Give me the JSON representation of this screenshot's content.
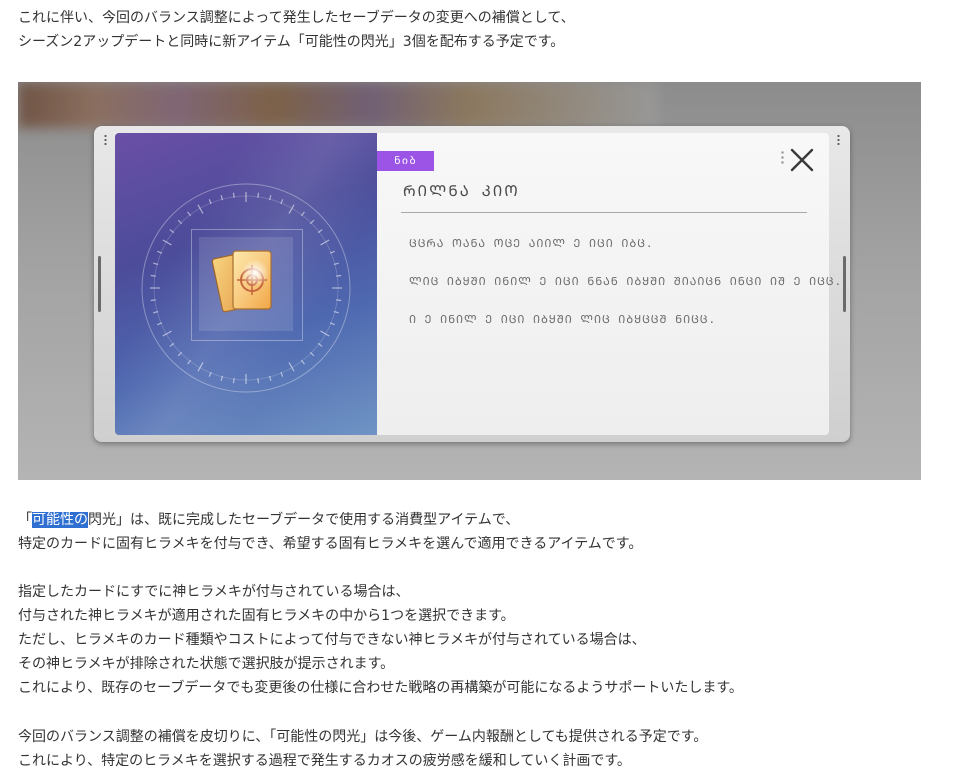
{
  "article": {
    "intro_lines": [
      "これに伴い、今回のバランス調整によって発生したセーブデータの変更への補償として、",
      "シーズン2アップデートと同時に新アイテム「可能性の閃光」3個を配布する予定です。"
    ],
    "desc": {
      "line1_open": "「",
      "line1_highlight": "可能性の",
      "line1_rest": "閃光」は、既に完成したセーブデータで使用する消費型アイテムで、",
      "line2": "特定のカードに固有ヒラメキを付与でき、希望する固有ヒラメキを選んで適用できるアイテムです。"
    },
    "rules_lines": [
      "指定したカードにすでに神ヒラメキが付与されている場合は、",
      "付与された神ヒラメキが適用された固有ヒラメキの中から1つを選択できます。",
      "ただし、ヒラメキのカード種類やコストによって付与できない神ヒラメキが付与されている場合は、",
      "その神ヒラメキが排除された状態で選択肢が提示されます。",
      "これにより、既存のセーブデータでも変更後の仕様に合わせた戦略の再構築が可能になるようサポートいたします。"
    ],
    "closing_lines": [
      "今回のバランス調整の補償を皮切りに、「可能性の閃光」は今後、ゲーム内報酬としても提供される予定です。",
      "これにより、特定のヒラメキを選択する過程で発生するカオスの疲労感を緩和していく計画です。"
    ]
  },
  "game_popup": {
    "tag": "ნიბ",
    "title": "ᲠᲘᲚᲜᲐ ᲙᲘᲝ",
    "desc_lines": [
      "ᲪᲪᲠᲐ ᲝᲐᲜᲐ ᲝᲪᲔ ᲐᲘᲘᲚ Ე ᲘᲪᲘ ᲘᲑᲪ.",
      "ᲚᲘᲪ ᲘᲑᲧᲨᲘ ᲘᲜᲘᲚ Ე ᲘᲪᲘ ᲜᲜᲐᲜ ᲘᲑᲧᲨᲘ ᲨᲘᲐᲘᲪᲜ ᲘᲜᲪᲘ ᲘᲨ Ე ᲘᲪᲪ.",
      "Ი Ე ᲘᲜᲘᲚ Ე ᲘᲪᲘ ᲘᲑᲧᲨᲘ ᲚᲘᲪ ᲘᲑᲧᲪᲪᲨ ᲜᲘᲪᲪ."
    ],
    "item_icon": "golden-card-icon",
    "close_icon": "close-x-icon",
    "accent_color": "#9b54e6"
  }
}
